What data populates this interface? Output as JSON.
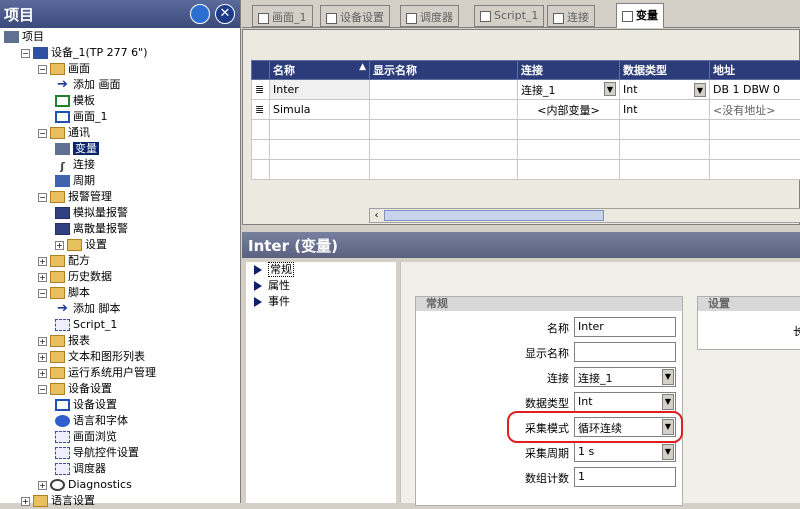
{
  "left_panel": {
    "title": "项目",
    "tree": [
      {
        "label": "项目",
        "depth": 0,
        "icon": "project-icon",
        "expander": ""
      },
      {
        "label": "设备_1(TP 277 6\")",
        "depth": 1,
        "icon": "device-icon",
        "expander": "−"
      },
      {
        "label": "画面",
        "depth": 2,
        "icon": "folder-icon",
        "expander": "−"
      },
      {
        "label": "添加 画面",
        "depth": 3,
        "icon": "add-icon",
        "expander": ""
      },
      {
        "label": "模板",
        "depth": 3,
        "icon": "template-icon",
        "expander": ""
      },
      {
        "label": "画面_1",
        "depth": 3,
        "icon": "screen-icon",
        "expander": ""
      },
      {
        "label": "通讯",
        "depth": 2,
        "icon": "folder-icon",
        "expander": "−"
      },
      {
        "label": "变量",
        "depth": 3,
        "icon": "tag-icon",
        "expander": "",
        "selected": true
      },
      {
        "label": "连接",
        "depth": 3,
        "icon": "connection-icon",
        "expander": ""
      },
      {
        "label": "周期",
        "depth": 3,
        "icon": "cycle-icon",
        "expander": ""
      },
      {
        "label": "报警管理",
        "depth": 2,
        "icon": "folder-icon",
        "expander": "−"
      },
      {
        "label": "模拟量报警",
        "depth": 3,
        "icon": "alarm-icon",
        "expander": ""
      },
      {
        "label": "离散量报警",
        "depth": 3,
        "icon": "alarm-icon",
        "expander": ""
      },
      {
        "label": "设置",
        "depth": 3,
        "icon": "folder-icon",
        "expander": "+"
      },
      {
        "label": "配方",
        "depth": 2,
        "icon": "folder-icon",
        "expander": "+"
      },
      {
        "label": "历史数据",
        "depth": 2,
        "icon": "folder-icon",
        "expander": "+"
      },
      {
        "label": "脚本",
        "depth": 2,
        "icon": "folder-icon",
        "expander": "−"
      },
      {
        "label": "添加 脚本",
        "depth": 3,
        "icon": "add-icon",
        "expander": ""
      },
      {
        "label": "Script_1",
        "depth": 3,
        "icon": "script-icon",
        "expander": ""
      },
      {
        "label": "报表",
        "depth": 2,
        "icon": "folder-icon",
        "expander": "+"
      },
      {
        "label": "文本和图形列表",
        "depth": 2,
        "icon": "folder-icon",
        "expander": "+"
      },
      {
        "label": "运行系统用户管理",
        "depth": 2,
        "icon": "folder-icon",
        "expander": "+"
      },
      {
        "label": "设备设置",
        "depth": 2,
        "icon": "folder-icon",
        "expander": "−"
      },
      {
        "label": "设备设置",
        "depth": 3,
        "icon": "device-settings-icon",
        "expander": ""
      },
      {
        "label": "语言和字体",
        "depth": 3,
        "icon": "globe-icon",
        "expander": ""
      },
      {
        "label": "画面浏览",
        "depth": 3,
        "icon": "navigation-icon",
        "expander": ""
      },
      {
        "label": "导航控件设置",
        "depth": 3,
        "icon": "navigation-icon",
        "expander": ""
      },
      {
        "label": "调度器",
        "depth": 3,
        "icon": "scheduler-icon",
        "expander": ""
      },
      {
        "label": "Diagnostics",
        "depth": 2,
        "icon": "diagnostics-icon",
        "expander": "+"
      },
      {
        "label": "语言设置",
        "depth": 1,
        "icon": "folder-icon",
        "expander": "+"
      }
    ]
  },
  "tabs": [
    {
      "label": "画面_1",
      "icon": "screen-icon",
      "active": false
    },
    {
      "label": "设备设置",
      "icon": "device-settings-icon",
      "active": false
    },
    {
      "label": "调度器",
      "icon": "scheduler-icon",
      "active": false
    },
    {
      "label": "Script_1",
      "icon": "script-icon",
      "active": false
    },
    {
      "label": "连接",
      "icon": "connection-icon",
      "active": false
    },
    {
      "label": "变量",
      "icon": "tag-icon",
      "active": true
    }
  ],
  "grid": {
    "headers": [
      "名称",
      "显示名称",
      "连接",
      "数据类型",
      "地址"
    ],
    "rows": [
      {
        "name": "Inter",
        "display_name": "",
        "connection": "连接_1",
        "data_type": "Int",
        "address": "DB 1 DBW 0",
        "has_dropdowns": true
      },
      {
        "name": "Simula",
        "display_name": "",
        "connection": "<内部变量>",
        "data_type": "Int",
        "address": "<没有地址>",
        "has_dropdowns": false
      }
    ]
  },
  "properties": {
    "title": "Inter (变量)",
    "nav": [
      "常规",
      "属性",
      "事件"
    ],
    "general_group_title": "常规",
    "settings_group_title": "设置",
    "settings_cut_label": "长",
    "fields": [
      {
        "label": "名称",
        "value": "Inter",
        "dropdown": false
      },
      {
        "label": "显示名称",
        "value": "",
        "dropdown": false
      },
      {
        "label": "连接",
        "value": "连接_1",
        "dropdown": true
      },
      {
        "label": "数据类型",
        "value": "Int",
        "dropdown": true
      },
      {
        "label": "采集模式",
        "value": "循环连续",
        "dropdown": true
      },
      {
        "label": "采集周期",
        "value": "1 s",
        "dropdown": true
      },
      {
        "label": "数组计数",
        "value": "1",
        "dropdown": false
      }
    ]
  },
  "colors": {
    "highlight": "#e02020",
    "header_bg": "#2c3c7a",
    "selection": "#0a246a"
  }
}
